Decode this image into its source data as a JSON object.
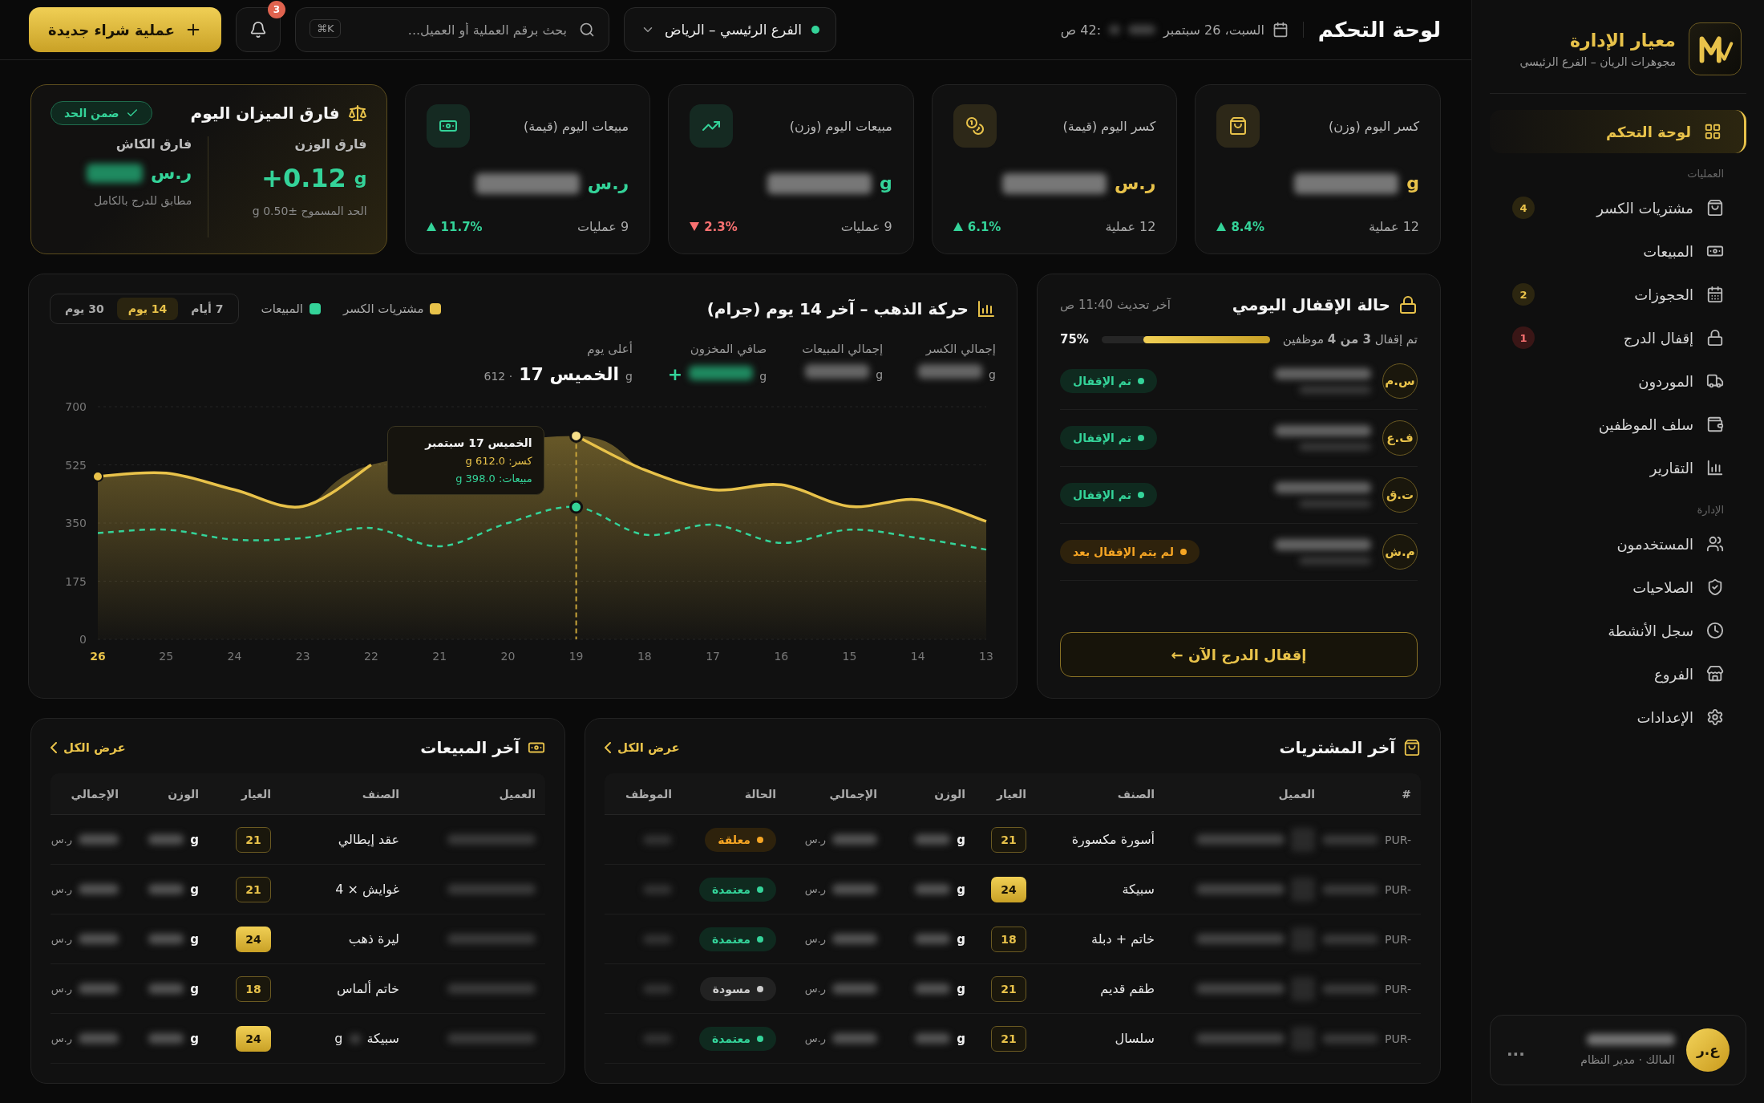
{
  "sidebar": {
    "brand": "معيار الإدارة",
    "subtitle": "مجوهرات الريان – الفرع الرئيسي",
    "sections": [
      {
        "items": [
          {
            "label": "لوحة التحكم",
            "selected": true
          }
        ]
      },
      {
        "title": "العمليات",
        "items": [
          {
            "label": "مشتريات الكسر",
            "selected": false,
            "badge": "4",
            "badge_alert": false
          },
          {
            "label": "المبيعات",
            "selected": false
          },
          {
            "label": "الحجوزات",
            "selected": false,
            "badge": "2",
            "badge_alert": false
          },
          {
            "label": "إقفال الدرج",
            "selected": false,
            "badge": "1",
            "badge_alert": true
          },
          {
            "label": "الموردون",
            "selected": false
          },
          {
            "label": "سلف الموظفين",
            "selected": false
          },
          {
            "label": "التقارير",
            "selected": false
          }
        ]
      },
      {
        "title": "الإدارة",
        "items": [
          {
            "label": "المستخدمون",
            "selected": false
          },
          {
            "label": "الصلاحيات",
            "selected": false
          },
          {
            "label": "سجل الأنشطة",
            "selected": false
          },
          {
            "label": "الفروع",
            "selected": false
          },
          {
            "label": "الإعدادات",
            "selected": false
          }
        ]
      }
    ],
    "user": {
      "initials": "ع.ر",
      "role": "المالك · مدير النظام",
      "more": "..."
    }
  },
  "topbar": {
    "title": "لوحة التحكم",
    "date": "السبت، 26 سبتمبر",
    "time": ":42 ص",
    "branch": "الفرع الرئيسي – الرياض",
    "search": {
      "placeholder": "بحث برقم العملية أو العميل...",
      "shortcut": "⌘K"
    },
    "notifications": "3",
    "new_button": "عملية شراء جديدة"
  },
  "kpis": [
    {
      "label": "كسر اليوم (وزن)",
      "unit": "g",
      "color": "#e8c24a",
      "count": "12 عملية",
      "change": "8.4%",
      "rising": true
    },
    {
      "label": "كسر اليوم (قيمة)",
      "unit": "ر.س",
      "color": "#e8c24a",
      "count": "12 عملية",
      "change": "6.1%",
      "rising": true
    },
    {
      "label": "مبيعات اليوم (وزن)",
      "unit": "g",
      "color": "#34d399",
      "count": "9 عمليات",
      "change": "2.3%",
      "rising": false
    },
    {
      "label": "مبيعات اليوم (قيمة)",
      "unit": "ر.س",
      "color": "#34d399",
      "count": "9 عمليات",
      "change": "11.7%",
      "rising": true
    }
  ],
  "balance": {
    "title": "فارق الميزان اليوم",
    "status": "ضمن الحد",
    "columns": [
      {
        "label": "فارق الوزن",
        "unit": "g",
        "value": "+0.12",
        "note": "الحد المسموح ±0.50 g"
      },
      {
        "label": "فارق الكاش",
        "unit": "ر.س",
        "note": "مطابق للدرج بالكامل"
      }
    ]
  },
  "gold_chart": {
    "title": "حركة الذهب – آخر 14 يوم (جرام)",
    "ranges": [
      {
        "label": "7 أيام",
        "selected": false
      },
      {
        "label": "14 يوم",
        "selected": true
      },
      {
        "label": "30 يوم",
        "selected": false
      }
    ],
    "stats": [
      {
        "label": "إجمالي الكسر",
        "unit": "g"
      },
      {
        "label": "إجمالي المبيعات",
        "unit": "g"
      },
      {
        "label": "صافي المخزون",
        "unit": "g",
        "sign": "+"
      },
      {
        "label": "أعلى يوم",
        "unit": "g",
        "value": "الخميس 17",
        "extra": "· 612"
      }
    ],
    "highlight_first_day": true,
    "tooltip": {
      "title": "الخميس 17 سبتمبر",
      "lines": [
        "كسر: 612.0 g",
        "مبيعات: 398.0 g"
      ]
    },
    "chart_data": {
      "type": "area",
      "grid": true,
      "ref_lines": [
        {
          "axis": "x",
          "value": "19"
        }
      ],
      "categories": [
        "26",
        "25",
        "24",
        "23",
        "22",
        "21",
        "20",
        "19",
        "18",
        "17",
        "16",
        "15",
        "14",
        "13"
      ],
      "ylim": [
        0,
        700
      ],
      "yticks": [
        0,
        175,
        350,
        525,
        700
      ],
      "series": [
        {
          "name": "مشتريات الكسر",
          "color": "#e8c24a",
          "type": "area",
          "line_style": "solid",
          "values": [
            490,
            500,
            450,
            400,
            525,
            null,
            null,
            612,
            510,
            450,
            465,
            400,
            420,
            355
          ]
        },
        {
          "name": "المبيعات",
          "color": "#34d399",
          "type": "line",
          "line_style": "dashed",
          "values": [
            320,
            330,
            300,
            305,
            335,
            280,
            350,
            398,
            315,
            345,
            290,
            330,
            305,
            270
          ]
        }
      ]
    }
  },
  "closing": {
    "title": "حالة الإقفال اليومي",
    "updated": "آخر تحديث 11:40 ص",
    "progress_text": "تم إقفال **3 من 4** موظفين",
    "percent": "75%",
    "level": 0.75,
    "employees": [
      {
        "initials": "س.م",
        "kind": "closed",
        "status_label": "تم الإقفال"
      },
      {
        "initials": "ف.ع",
        "kind": "closed",
        "status_label": "تم الإقفال"
      },
      {
        "initials": "ت.ق",
        "kind": "closed",
        "status_label": "تم الإقفال"
      },
      {
        "initials": "م.ش",
        "kind": "pending",
        "status_label": "لم يتم الإقفال بعد"
      }
    ],
    "button": "إقفال الدرج الآن ←"
  },
  "purchases": {
    "title": "آخر المشتريات",
    "view_all": "عرض الكل",
    "columns": [
      "#",
      "العميل",
      "الصنف",
      "العيار",
      "الوزن",
      "الإجمالي",
      "الحالة",
      "الموظف"
    ],
    "rows": [
      {
        "id_prefix": "PUR-",
        "item": "أسورة مكسورة",
        "karat": "21",
        "karat_filled": false,
        "weight_unit": "g",
        "total_unit": "ر.س",
        "kind": "pending",
        "status_label": "معلقة"
      },
      {
        "id_prefix": "PUR-",
        "item": "سبيكة",
        "karat": "24",
        "karat_filled": true,
        "weight_unit": "g",
        "total_unit": "ر.س",
        "kind": "approved",
        "status_label": "معتمدة"
      },
      {
        "id_prefix": "PUR-",
        "item": "خاتم + دبلة",
        "karat": "18",
        "karat_filled": false,
        "weight_unit": "g",
        "total_unit": "ر.س",
        "kind": "approved",
        "status_label": "معتمدة"
      },
      {
        "id_prefix": "PUR-",
        "item": "طقم قديم",
        "karat": "21",
        "karat_filled": false,
        "weight_unit": "g",
        "total_unit": "ر.س",
        "kind": "draft",
        "status_label": "مسودة"
      },
      {
        "id_prefix": "PUR-",
        "item": "سلسال",
        "karat": "21",
        "karat_filled": false,
        "weight_unit": "g",
        "total_unit": "ر.س",
        "kind": "approved",
        "status_label": "معتمدة"
      }
    ]
  },
  "sales": {
    "title": "آخر المبيعات",
    "view_all": "عرض الكل",
    "columns": [
      "العميل",
      "الصنف",
      "العيار",
      "الوزن",
      "الإجمالي"
    ],
    "rows": [
      {
        "item": "عقد إيطالي",
        "karat": "21",
        "karat_filled": false,
        "weight_unit": "g",
        "total_unit": "ر.س"
      },
      {
        "item": "غوايش × 4",
        "karat": "21",
        "karat_filled": false,
        "weight_unit": "g",
        "total_unit": "ر.س"
      },
      {
        "item": "ليرة ذهب",
        "karat": "24",
        "karat_filled": true,
        "weight_unit": "g",
        "total_unit": "ر.س"
      },
      {
        "item": "خاتم ألماس",
        "karat": "18",
        "karat_filled": false,
        "weight_unit": "g",
        "total_unit": "ر.س"
      },
      {
        "item": "سبيكة",
        "item_suffix": "g",
        "karat": "24",
        "karat_filled": true,
        "weight_unit": "g",
        "total_unit": "ر.س"
      }
    ]
  }
}
